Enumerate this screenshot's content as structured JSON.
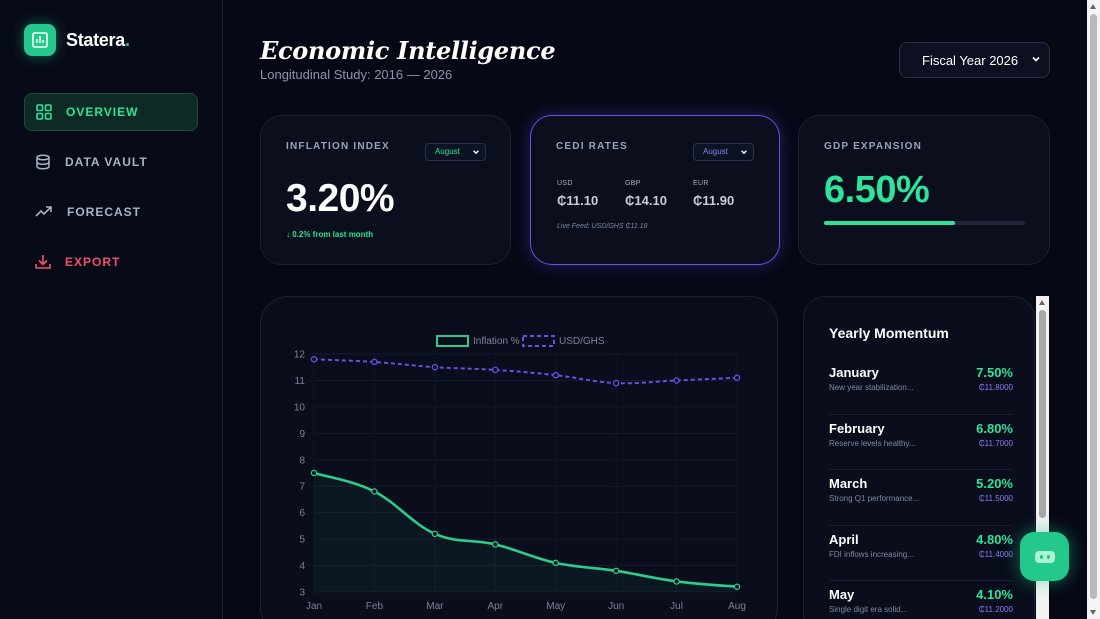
{
  "brand": {
    "name": "Statera",
    "dot": ".",
    "accent": "#22c98a"
  },
  "sidebar": {
    "items": [
      {
        "label": "OVERVIEW",
        "icon": "grid-icon",
        "active": true
      },
      {
        "label": "DATA VAULT",
        "icon": "database-icon"
      },
      {
        "label": "FORECAST",
        "icon": "trend-up-icon"
      },
      {
        "label": "EXPORT",
        "icon": "download-icon",
        "color": "#f0506e"
      }
    ]
  },
  "header": {
    "title": "Economic Intelligence",
    "subtitle": "Longitudinal Study: 2016 — 2026",
    "fiscal_select": "Fiscal Year 2026"
  },
  "cards": {
    "inflation": {
      "label": "INFLATION INDEX",
      "month": "August",
      "value": "3.20%",
      "delta": "↓ 0.2% from last month"
    },
    "cedi": {
      "label": "CEDI RATES",
      "month": "August",
      "rates": [
        {
          "cur": "USD",
          "val": "₵11.10"
        },
        {
          "cur": "GBP",
          "val": "₵14.10"
        },
        {
          "cur": "EUR",
          "val": "₵11.90"
        }
      ],
      "live": "Live Feed: USD/GHS ₵11.18",
      "border_color": "#6a4ee8"
    },
    "gdp": {
      "label": "GDP EXPANSION",
      "value": "6.50%",
      "progress": 0.65
    }
  },
  "chart_data": {
    "type": "line",
    "categories": [
      "Jan",
      "Feb",
      "Mar",
      "Apr",
      "May",
      "Jun",
      "Jul",
      "Aug"
    ],
    "series": [
      {
        "name": "Inflation %",
        "values": [
          7.5,
          6.8,
          5.2,
          4.8,
          4.1,
          3.8,
          3.4,
          3.2
        ],
        "color": "#2ecb8c",
        "style": "solid"
      },
      {
        "name": "USD/GHS",
        "values": [
          11.8,
          11.7,
          11.5,
          11.4,
          11.2,
          10.9,
          11.0,
          11.1
        ],
        "color": "#6a4ee8",
        "style": "dashed"
      }
    ],
    "ylim": [
      3,
      12
    ],
    "yticks": [
      "12",
      "11",
      "10",
      "9",
      "8",
      "7",
      "6",
      "5",
      "4",
      "3"
    ],
    "legend": "top-center",
    "grid": true
  },
  "momentum": {
    "title": "Yearly Momentum",
    "rows": [
      {
        "month": "January",
        "note": "New year stabilization...",
        "pct": "7.50%",
        "fx": "₵11.8000"
      },
      {
        "month": "February",
        "note": "Reserve levels healthy...",
        "pct": "6.80%",
        "fx": "₵11.7000"
      },
      {
        "month": "March",
        "note": "Strong Q1 performance...",
        "pct": "5.20%",
        "fx": "₵11.5000"
      },
      {
        "month": "April",
        "note": "FDI inflows increasing...",
        "pct": "4.80%",
        "fx": "₵11.4000"
      },
      {
        "month": "May",
        "note": "Single digit era solid...",
        "pct": "4.10%",
        "fx": "₵11.2000"
      }
    ]
  }
}
